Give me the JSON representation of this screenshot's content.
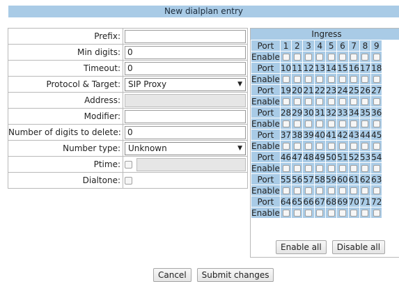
{
  "header": {
    "title": "New dialplan entry"
  },
  "form": {
    "prefix": {
      "label": "Prefix:",
      "value": ""
    },
    "min_digits": {
      "label": "Min digits:",
      "value": "0"
    },
    "timeout": {
      "label": "Timeout:",
      "value": "0"
    },
    "protocol_target": {
      "label": "Protocol & Target:",
      "value": "SIP Proxy"
    },
    "address": {
      "label": "Address:",
      "value": ""
    },
    "modifier": {
      "label": "Modifier:",
      "value": ""
    },
    "digits_to_delete": {
      "label": "Number of digits to delete:",
      "value": "0"
    },
    "number_type": {
      "label": "Number type:",
      "value": "Unknown"
    },
    "ptime": {
      "label": "Ptime:",
      "value": ""
    },
    "dialtone": {
      "label": "Dialtone:"
    }
  },
  "ingress": {
    "title": "Ingress",
    "port_label": "Port",
    "enable_label": "Enable",
    "rows": [
      [
        "1",
        "2",
        "3",
        "4",
        "5",
        "6",
        "7",
        "8",
        "9"
      ],
      [
        "10",
        "11",
        "12",
        "13",
        "14",
        "15",
        "16",
        "17",
        "18"
      ],
      [
        "19",
        "20",
        "21",
        "22",
        "23",
        "24",
        "25",
        "26",
        "27"
      ],
      [
        "28",
        "29",
        "30",
        "31",
        "32",
        "33",
        "34",
        "35",
        "36"
      ],
      [
        "37",
        "38",
        "39",
        "40",
        "41",
        "42",
        "43",
        "44",
        "45"
      ],
      [
        "46",
        "47",
        "48",
        "49",
        "50",
        "51",
        "52",
        "53",
        "54"
      ],
      [
        "55",
        "56",
        "57",
        "58",
        "59",
        "60",
        "61",
        "62",
        "63"
      ],
      [
        "64",
        "65",
        "66",
        "67",
        "68",
        "69",
        "70",
        "71",
        "72"
      ]
    ],
    "enable_all": "Enable all",
    "disable_all": "Disable all"
  },
  "actions": {
    "cancel": "Cancel",
    "submit": "Submit changes"
  }
}
